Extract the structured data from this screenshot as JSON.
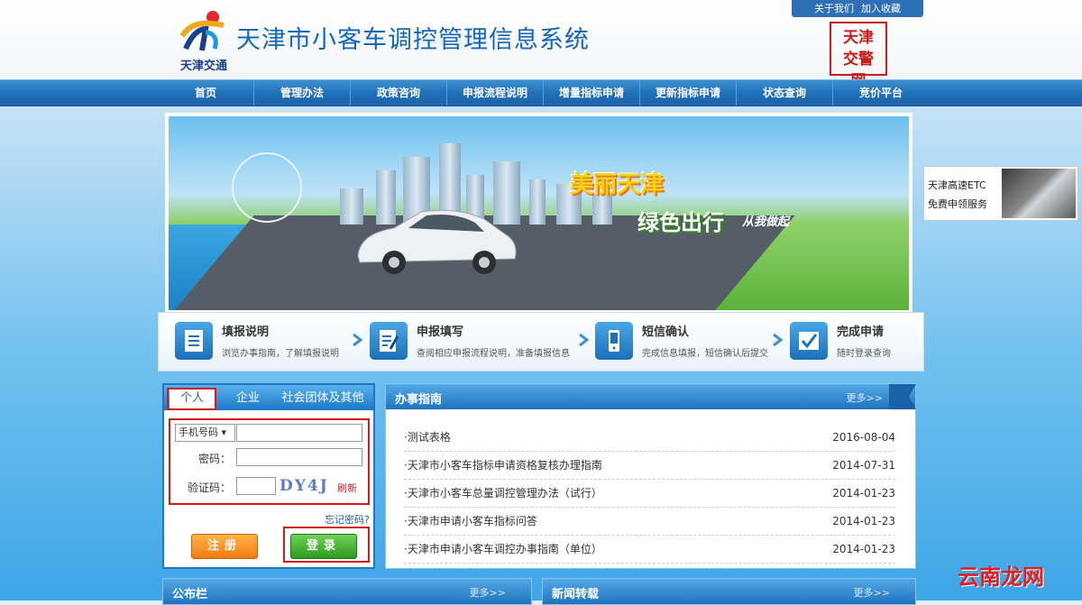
{
  "header": {
    "title": "天津市小客车调控管理信息系统",
    "logo_text": "天津交通",
    "seal_text": "天津交警网",
    "toplinks": [
      "关于我们",
      "加入收藏"
    ]
  },
  "nav": {
    "items": [
      "首页",
      "管理办法",
      "政策咨询",
      "申报流程说明",
      "增量指标申请",
      "更新指标申请",
      "状态查询",
      "竞价平台"
    ]
  },
  "banner": {
    "slogan1": "美丽天津",
    "slogan2": "绿色出行",
    "slogan3": "从我做起"
  },
  "steps": [
    {
      "title": "填报说明",
      "desc": "浏览办事指南，了解填报说明"
    },
    {
      "title": "申报填写",
      "desc": "查阅相应申报流程说明，准备填报信息"
    },
    {
      "title": "短信确认",
      "desc": "完成信息填报，短信确认后提交"
    },
    {
      "title": "完成申请",
      "desc": "随时登录查询"
    }
  ],
  "login": {
    "tabs": [
      "个人",
      "企业",
      "社会团体及其他"
    ],
    "id_type": "手机号码",
    "password_label": "密码：",
    "captcha_label": "验证码：",
    "captcha_text": "DY4J",
    "refresh": "刷新",
    "forgot": "忘记密码?",
    "register": "注册",
    "login": "登录"
  },
  "guide": {
    "title": "办事指南",
    "more": "更多>>",
    "items": [
      {
        "text": "·测试表格",
        "date": "2016-08-04"
      },
      {
        "text": "·天津市小客车指标申请资格复核办理指南",
        "date": "2014-07-31"
      },
      {
        "text": "·天津市小客车总量调控管理办法（试行）",
        "date": "2014-01-23"
      },
      {
        "text": "·天津市申请小客车指标问答",
        "date": "2014-01-23"
      },
      {
        "text": "·天津市申请小客车调控办事指南（单位）",
        "date": "2014-01-23"
      }
    ]
  },
  "bottom": {
    "notice_title": "公布栏",
    "notice_more": "更多>>",
    "news_title": "新闻转载",
    "news_more": "更多>>"
  },
  "etc": {
    "line1": "天津高速ETC",
    "line2": "免费申领服务"
  },
  "watermark": "云南龙网",
  "colors": {
    "brand": "#1f6fb8",
    "highlight": "#d21c1c",
    "login_btn": "#2f9a1f",
    "register_btn": "#f07b12"
  }
}
